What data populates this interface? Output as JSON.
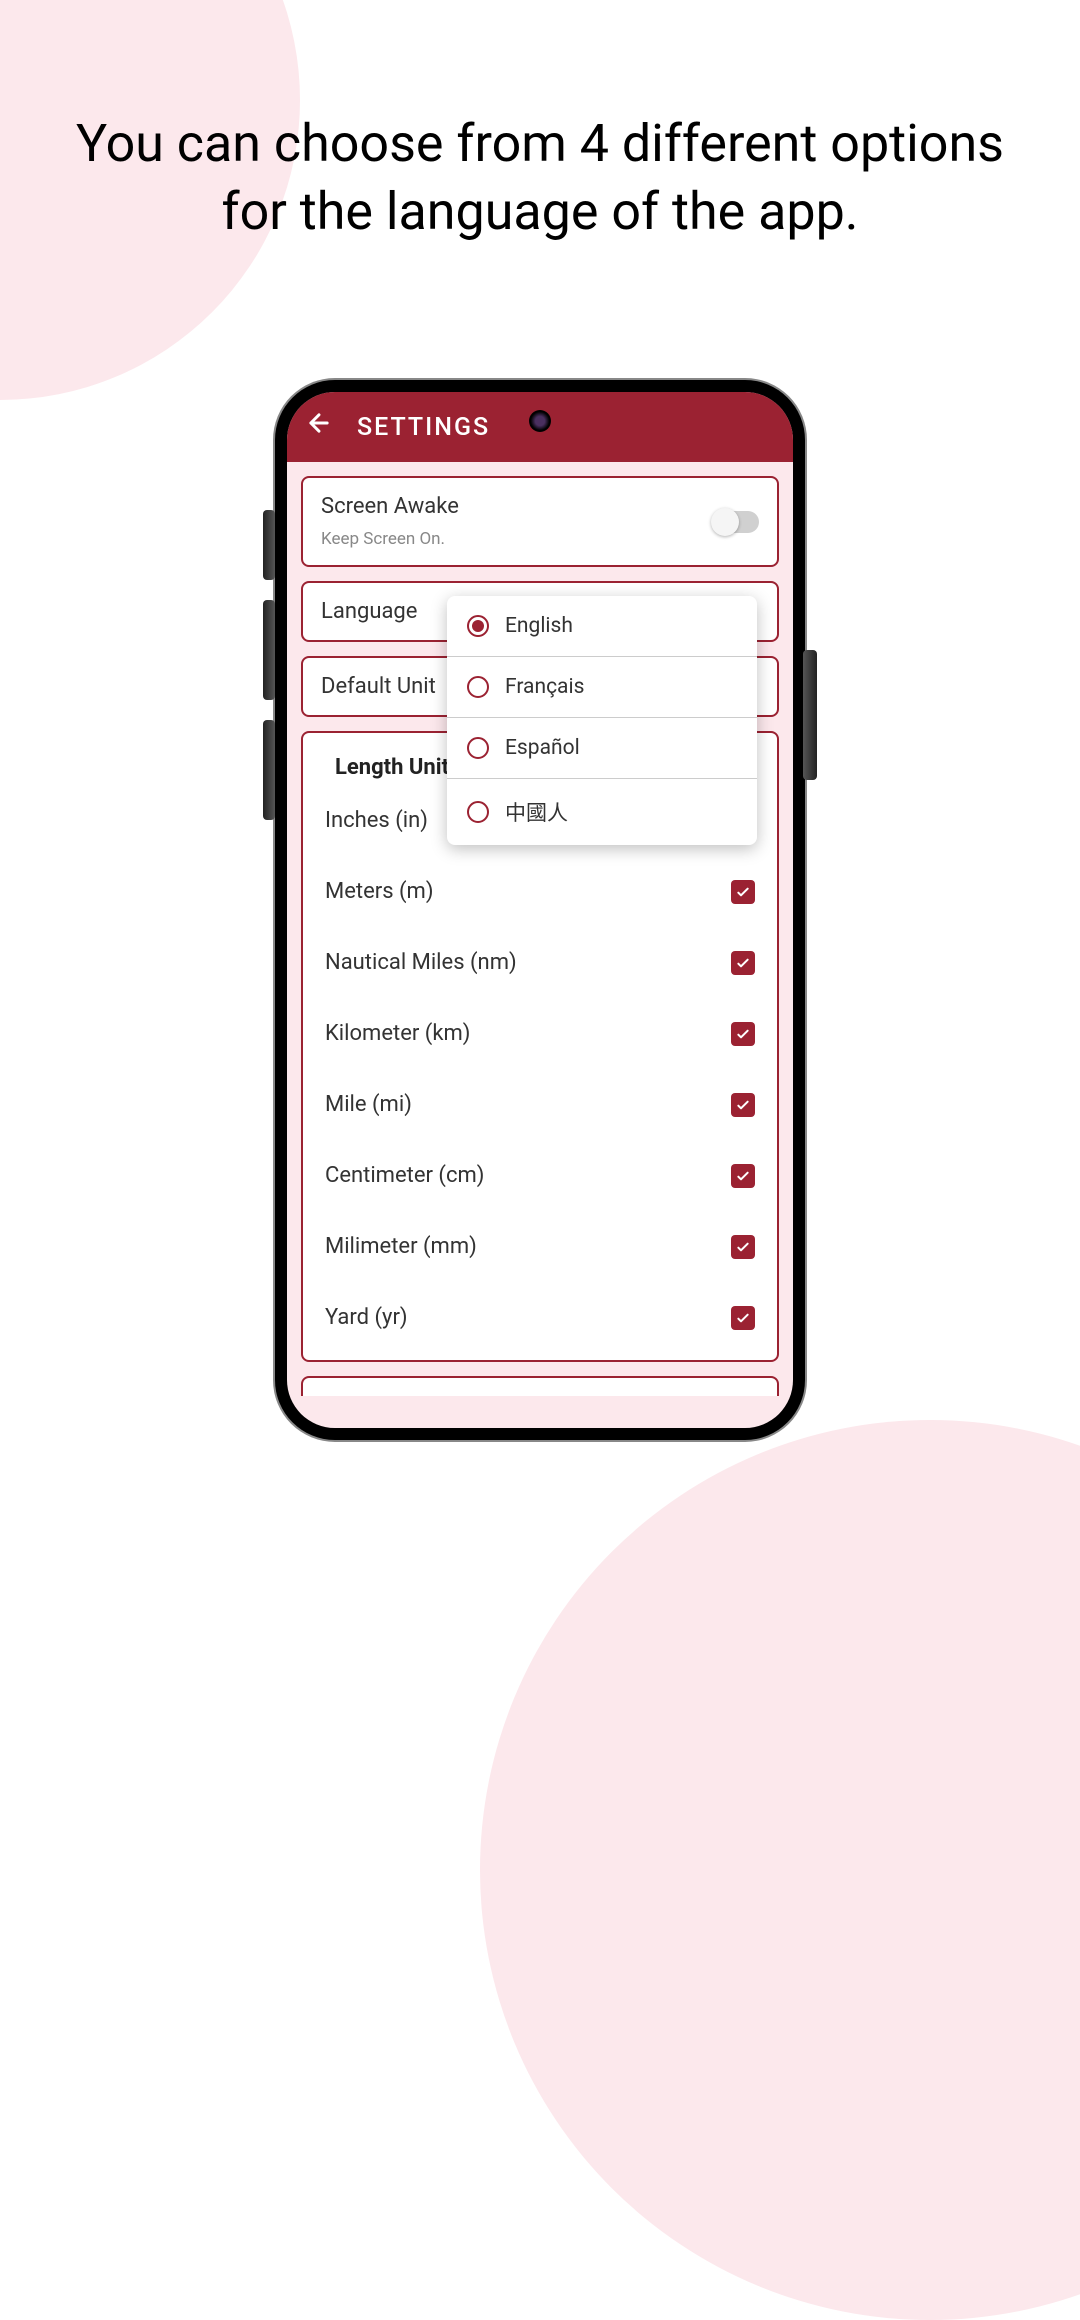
{
  "promo": {
    "text": "You can choose from 4 different options for the language of the app."
  },
  "colors": {
    "accent": "#9b2232",
    "bg_light": "#fce8ec"
  },
  "appbar": {
    "title": "SETTINGS"
  },
  "screen_awake": {
    "title": "Screen Awake",
    "subtitle": "Keep Screen On.",
    "enabled": false
  },
  "language": {
    "label": "Language",
    "selected": "English",
    "options": [
      {
        "label": "English",
        "selected": true
      },
      {
        "label": "Français",
        "selected": false
      },
      {
        "label": "Español",
        "selected": false
      },
      {
        "label": "中國人",
        "selected": false
      }
    ]
  },
  "default_unit": {
    "label": "Default Unit"
  },
  "length_units": {
    "title": "Length Unit",
    "items": [
      {
        "label": "Inches (in)",
        "checked": true
      },
      {
        "label": "Meters (m)",
        "checked": true
      },
      {
        "label": "Nautical Miles (nm)",
        "checked": true
      },
      {
        "label": "Kilometer (km)",
        "checked": true
      },
      {
        "label": "Mile (mi)",
        "checked": true
      },
      {
        "label": "Centimeter (cm)",
        "checked": true
      },
      {
        "label": "Milimeter (mm)",
        "checked": true
      },
      {
        "label": "Yard (yr)",
        "checked": true
      }
    ]
  }
}
